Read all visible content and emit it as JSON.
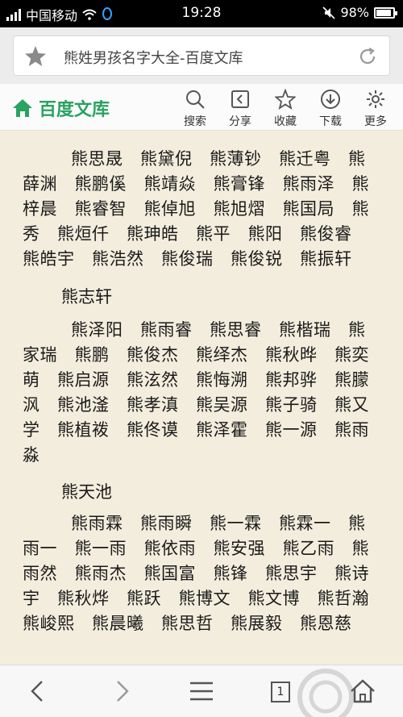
{
  "status_bar": {
    "carrier": "中国移动",
    "time": "19:28",
    "battery": "98%",
    "battery_level": 0.98
  },
  "address_bar": {
    "page_title": "熊姓男孩名字大全-百度文库"
  },
  "site_header": {
    "brand": "百度文库",
    "tools": [
      {
        "label": "搜索",
        "icon": "search-icon"
      },
      {
        "label": "分享",
        "icon": "share-icon"
      },
      {
        "label": "收藏",
        "icon": "star-icon"
      },
      {
        "label": "下载",
        "icon": "download-icon"
      },
      {
        "label": "更多",
        "icon": "gear-icon"
      }
    ]
  },
  "content": {
    "para1": "熊思晟　熊黛倪　熊薄钞　熊迁粤　熊薛渊　熊鹏傒　熊靖焱　熊膏锋　熊雨泽　熊梓晨　熊睿智　熊倬旭　熊旭熠　熊国局　熊秀　熊烜仟　熊珅皓　熊平　熊阳　熊俊睿　熊皓宇　熊浩然　熊俊瑞　熊俊锐　熊振轩",
    "heading1": "熊志轩",
    "para2": "熊泽阳　熊雨睿　熊思睿　熊楷瑞　熊家瑞　熊鹏　熊俊杰　熊绎杰　熊秋晔　熊奕萌　熊启源　熊泫然　熊悔溯　熊邦骅　熊朦沨　熊池滏　熊孝滇　熊吴源　熊子骑　熊又学　熊植袯　熊佟谟　熊泽霍　熊一源　熊雨淼",
    "heading2": "熊天池",
    "para3": "熊雨霖　熊雨瞬　熊一霖　熊霖一　熊雨一　熊一雨　熊依雨　熊安强　熊乙雨　熊雨然　熊雨杰　熊国富　熊锋　熊思宇　熊诗宇　熊秋烨　熊跃　熊博文　熊文博　熊哲瀚　熊峻熙　熊晨曦　熊思哲　熊展毅　熊恩慈"
  },
  "bottom_nav": {
    "tab_count": "1",
    "items": [
      "back-icon",
      "forward-icon",
      "menu-icon",
      "tabs-icon",
      "home-icon"
    ]
  },
  "colors": {
    "brand_green": "#2aa262",
    "page_background": "#f3eddd"
  }
}
